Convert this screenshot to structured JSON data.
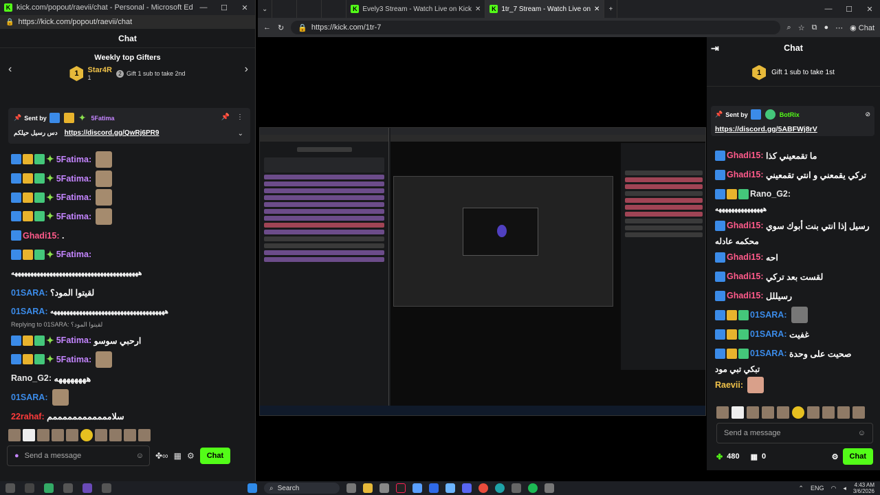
{
  "left_window": {
    "title": "kick.com/popout/raevii/chat - Personal - Microsoft Edge",
    "url": "https://kick.com/popout/raevii/chat",
    "chat_title": "Chat",
    "gifters": {
      "title": "Weekly top Gifters",
      "rank": "1",
      "name": "Star4R",
      "count": "1",
      "tip_rank": "2",
      "tip": "Gift 1 sub to take 2nd"
    },
    "pinned": {
      "sent_by": "Sent by",
      "user": "5Fatima",
      "user_note": "دس رسيل حيلكم",
      "link": "https://discord.gg/QwRj6PR9"
    },
    "messages": [
      {
        "user": "5Fatima:",
        "text": "",
        "color": "#c485ff",
        "emote": true
      },
      {
        "user": "5Fatima:",
        "text": "",
        "color": "#c485ff",
        "emote": true
      },
      {
        "user": "5Fatima:",
        "text": "",
        "color": "#c485ff",
        "emote": true
      },
      {
        "user": "5Fatima:",
        "text": "",
        "color": "#c485ff",
        "emote": true
      },
      {
        "user": "Ghadi15:",
        "text": ".",
        "color": "#ff5a8a",
        "emote": false
      },
      {
        "user": "5Fatima:",
        "text": "",
        "color": "#c485ff",
        "emote": false
      },
      {
        "user": "",
        "text": "ههههههههههههههههههههههههههههههههههههههههه",
        "color": "#ffffff",
        "emote": false
      },
      {
        "user": "01SARA:",
        "text": "لقيتوا المود؟",
        "color": "#3b8be8",
        "emote": false
      },
      {
        "user": "01SARA:",
        "text": "ههههههههههههههههههههههههههههههههههههه",
        "color": "#3b8be8",
        "emote": false
      },
      {
        "user": "5Fatima:",
        "text": "ارحبي سوسو",
        "color": "#c485ff",
        "emote": false
      },
      {
        "user": "5Fatima:",
        "text": "",
        "color": "#c485ff",
        "emote": true
      },
      {
        "user": "Rano_G2:",
        "text": "ههههههههه",
        "color": "#e6e6e6",
        "emote": false
      },
      {
        "user": "01SARA:",
        "text": "",
        "color": "#3b8be8",
        "emote": true
      },
      {
        "user": "22rahaf:",
        "text": "سلاممممممممممممم",
        "color": "#ff3b3b",
        "emote": false
      }
    ],
    "reply_note": "Replying to 01SARA: لقيتوا المود؟",
    "send_placeholder": "Send a message",
    "chat_button": "Chat"
  },
  "right_window": {
    "tabs": [
      {
        "label": "Evely3 Stream - Watch Live on Kick",
        "active": false
      },
      {
        "label": "1tr_7 Stream - Watch Live on",
        "active": true
      }
    ],
    "url": "https://kick.com/1tr-7",
    "side_chat": {
      "title": "Chat",
      "gift_rank": "1",
      "gift_tip": "Gift 1 sub to take 1st",
      "pinned_sent_by": "Sent by",
      "pinned_user": "BotRix",
      "pinned_link": "https://discord.gg/5ABFWj8rV",
      "messages": [
        {
          "user": "Ghadi15:",
          "text": "ما تقمعيني كذا",
          "color": "#ff5a8a"
        },
        {
          "user": "Ghadi15:",
          "text": "تركي يقمعني و انتي تقمعيني",
          "color": "#ff5a8a"
        },
        {
          "user": "Rano_G2:",
          "text": "",
          "color": "#e6e6e6"
        },
        {
          "user": "",
          "text": "هههههههههههههههه",
          "color": "#ffffff"
        },
        {
          "user": "Ghadi15:",
          "text": "رسيل إذا انتي بنت أبوك سوي",
          "color": "#ff5a8a"
        },
        {
          "user": "",
          "text": "محكمه عادله",
          "color": "#ffffff"
        },
        {
          "user": "Ghadi15:",
          "text": "احه",
          "color": "#ff5a8a"
        },
        {
          "user": "Ghadi15:",
          "text": "لقست بعد تركي",
          "color": "#ff5a8a"
        },
        {
          "user": "Ghadi15:",
          "text": "رسيللل",
          "color": "#ff5a8a"
        },
        {
          "user": "01SARA:",
          "text": "",
          "color": "#3b8be8"
        },
        {
          "user": "01SARA:",
          "text": "غفيت",
          "color": "#3b8be8"
        },
        {
          "user": "01SARA:",
          "text": "صحيت على وحدة",
          "color": "#3b8be8"
        },
        {
          "user": "",
          "text": "تبكي تبي مود",
          "color": "#ffffff"
        },
        {
          "user": "Raevii:",
          "text": "",
          "color": "#f0c24a"
        }
      ],
      "send_placeholder": "Send a message",
      "points": "480",
      "redeems": "0",
      "chat_button": "Chat"
    }
  },
  "taskbar": {
    "search": "Search",
    "lang": "ENG",
    "time": "4:43 AM",
    "date": "3/6/2026"
  }
}
